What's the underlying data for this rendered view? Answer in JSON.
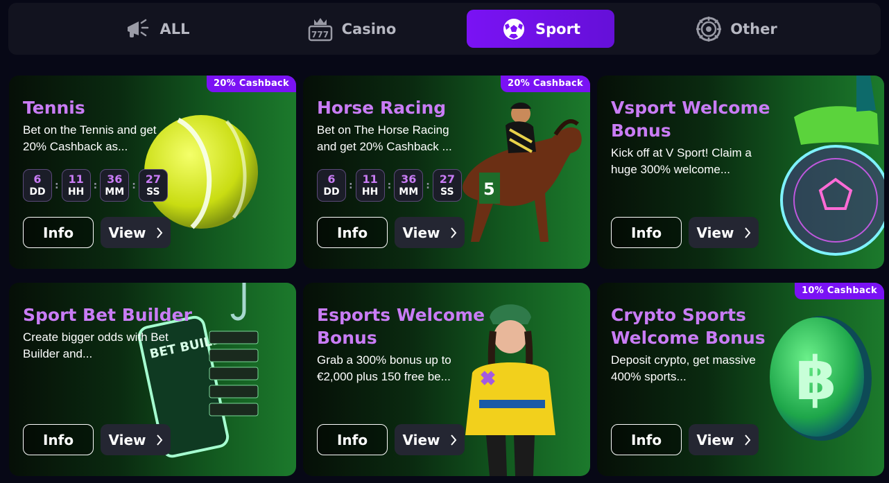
{
  "tabs": [
    {
      "label": "ALL",
      "icon": "megaphone-icon",
      "active": false
    },
    {
      "label": "Casino",
      "icon": "slot-machine-icon",
      "active": false
    },
    {
      "label": "Sport",
      "icon": "soccer-ball-icon",
      "active": true
    },
    {
      "label": "Other",
      "icon": "roulette-wheel-icon",
      "active": false
    }
  ],
  "timer_labels": {
    "days": "DD",
    "hours": "HH",
    "minutes": "MM",
    "seconds": "SS"
  },
  "buttons": {
    "info": "Info",
    "view": "View"
  },
  "colors": {
    "accent": "#7a12f4",
    "title": "#c97cf5",
    "background": "#070816"
  },
  "cards": [
    {
      "title": "Tennis",
      "desc": "Bet on the Tennis and get 20% Cashback as...",
      "badge": "20% Cashback",
      "timer": {
        "days": "6",
        "hours": "11",
        "minutes": "36",
        "seconds": "27"
      },
      "art": "tennis-ball-art"
    },
    {
      "title": "Horse Racing",
      "desc": "Bet on The Horse Racing and get 20% Cashback ...",
      "badge": "20% Cashback",
      "timer": {
        "days": "6",
        "hours": "11",
        "minutes": "36",
        "seconds": "27"
      },
      "art": "racehorse-art"
    },
    {
      "title": "Vsport Welcome Bonus",
      "desc": "Kick off at V Sport! Claim a huge 300% welcome...",
      "badge": "",
      "art": "neon-football-art"
    },
    {
      "title": "Sport Bet Builder",
      "desc": "Create bigger odds with Bet Builder and...",
      "badge": "",
      "art": "bet-builder-phone-art",
      "phone_text": "BET BUILDER"
    },
    {
      "title": "Esports Welcome Bonus",
      "desc": "Grab a 300% bonus up to €2,000 plus 150 free be...",
      "badge": "",
      "art": "esports-character-art"
    },
    {
      "title": "Crypto Sports Welcome Bonus",
      "desc": "Deposit crypto, get massive 400% sports...",
      "badge": "10% Cashback",
      "art": "bitcoin-coin-art"
    }
  ]
}
